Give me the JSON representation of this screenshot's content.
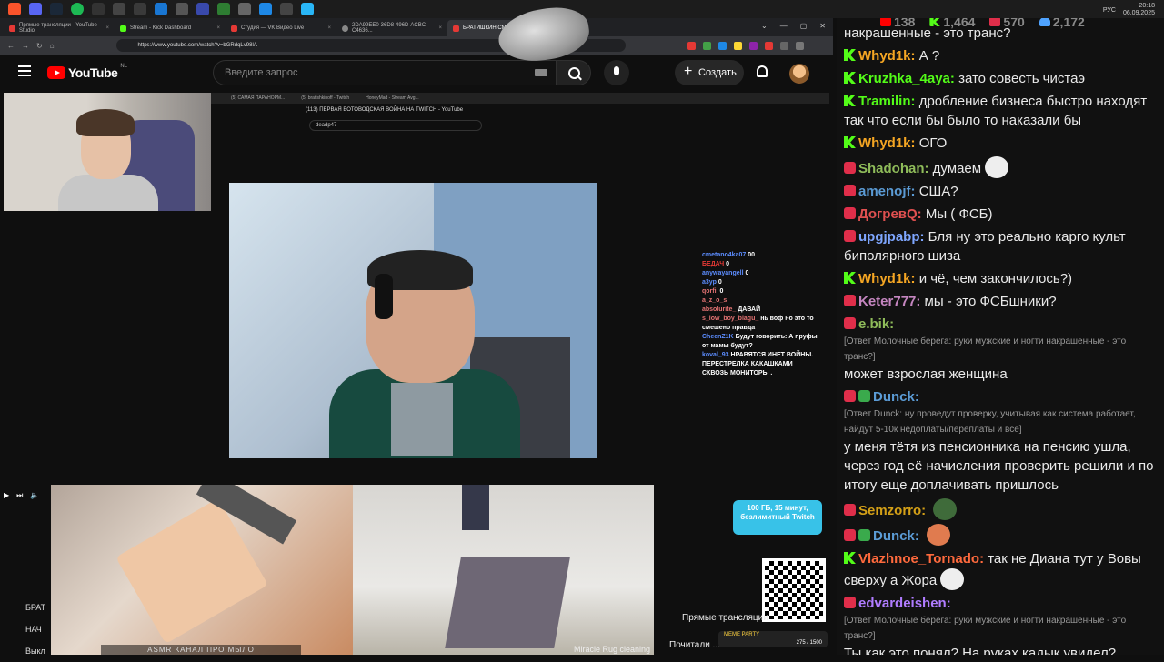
{
  "taskbar": {
    "clock_time": "20:18",
    "clock_date": "06.09.2025",
    "lang": "РУС"
  },
  "browser": {
    "tabs": [
      {
        "label": "Прямые трансляции - YouTube Studio"
      },
      {
        "label": "Stream - Kick Dashboard"
      },
      {
        "label": "Студия — VK Видео Live"
      },
      {
        "label": "2DA99EE0-36D8-496D-ACBC-C4636..."
      },
      {
        "label": "БРАТИШКИН СМОТРИТ: ПЕ..."
      }
    ],
    "url": "https://www.youtube.com/watch?v=bGRdqLv98lA"
  },
  "youtube": {
    "logo_text": "YouTube",
    "country": "NL",
    "search_placeholder": "Введите запрос",
    "create_label": "Создать"
  },
  "nested_browser": {
    "tabs": [
      "(5) САМАЯ ПАРАНОРМ...",
      "(5) bratishkinoff - Twitch",
      "HoneyMad - Stream Avg..."
    ],
    "title": "(113) ПЕРВАЯ БОТОВОДСКАЯ ВОЙНА НА TWITCH - YouTube",
    "search": "deadp47"
  },
  "mini_chat": [
    {
      "user": "cmetano4ka07",
      "text": "00"
    },
    {
      "user": "БЕДАЧ",
      "text": "0"
    },
    {
      "user": "anywayangell",
      "text": "0"
    },
    {
      "user": "a3yp",
      "text": "0"
    },
    {
      "user": "qorfil",
      "text": "0"
    },
    {
      "user": "a_z_o_s",
      "text": ""
    },
    {
      "user": "absolurite_",
      "text": "ДАВАЙ"
    },
    {
      "user": "s_low_boy_blagu_",
      "text": "нь воф но это то смешено правда"
    },
    {
      "user": "CheenZ1K",
      "text": "Будут говорить: А пруфы от мамы будут?"
    },
    {
      "user": "koval_93",
      "text": "НРАВЯТСЯ ИНЕТ ВОЙНЫ. ПЕРЕСТРЕЛКА КАКАШКАМИ СКВОЗЬ МОНИТОРЫ ."
    }
  ],
  "left_labels": [
    "БРАТ",
    "НАЧ",
    "Выкл"
  ],
  "overlays": {
    "soap_caption": "ASMR КАНАЛ ПРО МЫЛО",
    "rug_caption": "Miracle Rug cleaning",
    "badge_100": "100 ГБ, 15 минут, безлимитный Twitch",
    "meme_party": "MEME PARTY",
    "meme_progress": "275 / 1500",
    "live_label": "Прямые трансляции",
    "read_label": "Почитали ..."
  },
  "chat": {
    "stats": [
      {
        "platform": "youtube",
        "count": "138",
        "color": "#ff0000"
      },
      {
        "platform": "kick",
        "count": "1,464",
        "color": "#53fc18"
      },
      {
        "platform": "vk",
        "count": "570",
        "color": "#e02e4a"
      },
      {
        "platform": "viewers",
        "count": "2,172",
        "color": "#4fa3ff"
      }
    ],
    "messages": [
      {
        "platform": "none",
        "name": "",
        "color": "#eaeaea",
        "text": "накрашенные - это транс?"
      },
      {
        "platform": "kick",
        "name": "Whyd1k:",
        "color": "#f5a623",
        "text": "А ?"
      },
      {
        "platform": "kick",
        "name": "Kruzhka_4aya:",
        "color": "#53fc18",
        "text": "зато совесть чистаэ"
      },
      {
        "platform": "kick",
        "name": "Tramilin:",
        "color": "#53fc18",
        "text": "дробление бизнеса быстро находят так что если бы было то наказали бы"
      },
      {
        "platform": "kick",
        "name": "Whyd1k:",
        "color": "#f5a623",
        "text": "ОГО"
      },
      {
        "platform": "vk",
        "name": "Shadohan:",
        "color": "#8fbc5a",
        "text": "думаем"
      },
      {
        "platform": "vk",
        "name": "amenojf:",
        "color": "#5b9bd5",
        "text": "США?"
      },
      {
        "platform": "vk",
        "name": "ДогревQ:",
        "color": "#e05050",
        "text": "Мы ( ФСБ)"
      },
      {
        "platform": "vk",
        "name": "upgjpabp:",
        "color": "#7ea6ff",
        "text": "Бля ну это реально карго культ биполярного шиза"
      },
      {
        "platform": "kick",
        "name": "Whyd1k:",
        "color": "#f5a623",
        "text": "и чё, чем закончилось?)"
      },
      {
        "platform": "vk",
        "name": "Keter777:",
        "color": "#c586c0",
        "text": "мы - это ФСБшники?"
      },
      {
        "platform": "vk",
        "name": "e.bik:",
        "color": "#8fbc5a",
        "text": "",
        "reply": "[Ответ Молочные берега: руки мужские и ногти накрашенные - это транс?]",
        "after": "может взрослая женщина"
      },
      {
        "platform": "vk-check",
        "name": "Dunck:",
        "color": "#5b9bd5",
        "text": "",
        "reply": "[Ответ Dunck: ну проведут проверку, учитывая как система работает, найдут 5-10к недоплаты/переплаты и всё]",
        "after": "у меня тётя из пенсионника на пенсию ушла, через год её начисления проверить решили и по итогу еще доплачивать пришлось"
      },
      {
        "platform": "vk",
        "name": "Semzorro:",
        "color": "#d4a017",
        "text": ""
      },
      {
        "platform": "vk-check",
        "name": "Dunck:",
        "color": "#5b9bd5",
        "text": ""
      },
      {
        "platform": "kick",
        "name": "Vlazhnoe_Tornado:",
        "color": "#ff6a3d",
        "text": "так не Диана тут у Вовы сверху а Жора"
      },
      {
        "platform": "vk",
        "name": "edvardeishen:",
        "color": "#b07cff",
        "text": "",
        "reply": "[Ответ Молочные берега: руки мужские и ногти накрашенные - это транс?]",
        "after": "Ты как это понял? На руках кадык увидел?"
      }
    ]
  }
}
